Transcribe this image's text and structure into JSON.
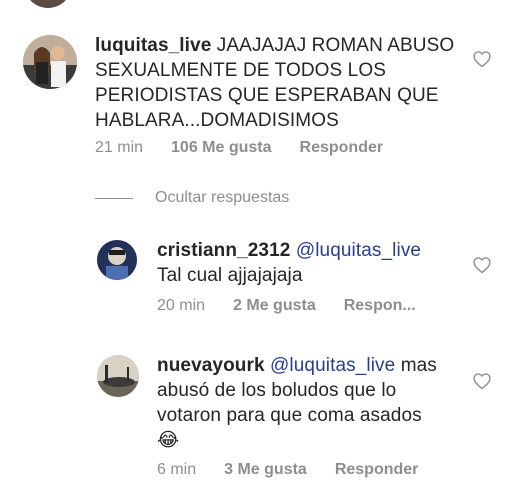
{
  "comments": [
    {
      "username": "luquitas_live",
      "text": "JAAJAJAJ ROMAN ABUSO SEXUALMENTE DE TODOS LOS PERIODISTAS QUE ESPERABAN QUE HABLARA...DOMADISIMOS",
      "time": "21 min",
      "likes": "106 Me gusta",
      "reply": "Responder"
    }
  ],
  "hide_replies": "Ocultar respuestas",
  "replies": [
    {
      "username": "cristiann_2312",
      "mention": "@luquitas_live",
      "text": "Tal cual ajjajajaja",
      "time": "20 min",
      "likes": "2 Me gusta",
      "reply": "Respon..."
    },
    {
      "username": "nuevayourk",
      "mention": "@luquitas_live",
      "text": "mas abusó de los boludos que lo votaron para que coma asados",
      "emoji": "😂",
      "time": "6 min",
      "likes": "3 Me gusta",
      "reply": "Responder"
    }
  ],
  "icons": {
    "like": "heart-outline-icon"
  },
  "colors": {
    "text": "#262626",
    "muted": "#8e8e8e",
    "mention": "#2b3d8f"
  }
}
